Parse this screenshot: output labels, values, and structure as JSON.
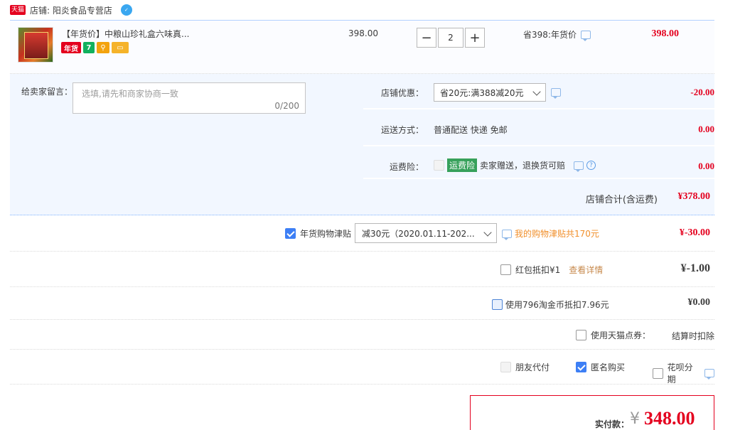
{
  "shop": {
    "badge": "天猫",
    "label": "店铺: 阳炎食品专营店",
    "wangwang": "✓"
  },
  "item": {
    "title": "【年货价】中粮山珍礼盒六味真...",
    "tags": {
      "nianhuo": "年货",
      "seven": "7",
      "gold": "⚲",
      "card": "▭"
    },
    "price": "398.00",
    "qty": {
      "minus": "−",
      "value": "2",
      "plus": "+"
    },
    "promo": "省398:年货价",
    "total": "398.00"
  },
  "message": {
    "label": "给卖家留言：",
    "placeholder": "选填,请先和商家协商一致",
    "count": "0/200"
  },
  "shop_coupon": {
    "label": "店铺优惠：",
    "selected": "省20元:满388减20元",
    "value": "-20.00"
  },
  "shipping": {
    "label": "运送方式：",
    "text": "普通配送 快递 免邮",
    "value": "0.00"
  },
  "insurance": {
    "label": "运费险：",
    "badge": "运费险",
    "text": "卖家赠送，退换货可赔",
    "value": "0.00",
    "q": "?"
  },
  "shop_total": {
    "label": "店铺合计(含运费)",
    "value": "¥378.00"
  },
  "subsidy": {
    "label": "年货购物津贴",
    "selected": "减30元（2020.01.11-202...",
    "info": "我的购物津贴共170元",
    "value": "¥-30.00"
  },
  "redpack": {
    "label": "红包抵扣¥1",
    "link": "查看详情",
    "value": "¥-1.00"
  },
  "coins": {
    "label": "使用796淘金币抵扣7.96元",
    "value": "¥0.00"
  },
  "points": {
    "label": "使用天猫点券：",
    "value": "结算时扣除"
  },
  "options": {
    "friends": "朋友代付",
    "anonymous": "匿名购买",
    "huabei": "花呗分期"
  },
  "pay": {
    "label": "实付款：",
    "currency": "¥",
    "amount": "348.00"
  }
}
